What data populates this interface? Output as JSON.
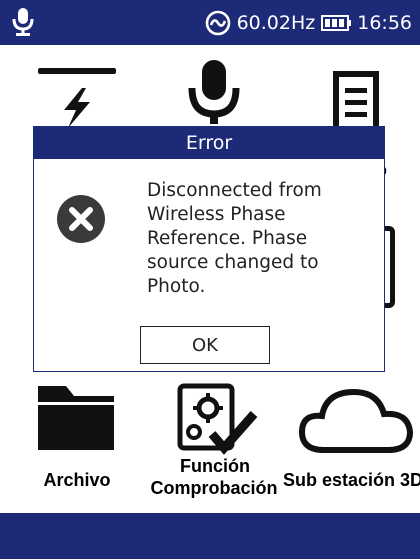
{
  "status_bar": {
    "frequency": "60.02Hz",
    "time": "16:56",
    "icons": [
      "microphone-icon",
      "phase-reference-icon",
      "battery-icon"
    ]
  },
  "tiles": [
    {
      "name": "tile-lightning",
      "label": "",
      "icon": "lightning-bar-icon"
    },
    {
      "name": "tile-microphone",
      "label": "",
      "icon": "microphone-icon"
    },
    {
      "name": "tile-document",
      "label": "o",
      "icon": "document-icon"
    },
    {
      "name": "tile-archivo",
      "label": "Archivo",
      "icon": "folder-icon"
    },
    {
      "name": "tile-funcion",
      "label_line1": "Función",
      "label_line2": "Comprobación",
      "icon": "gear-check-icon"
    },
    {
      "name": "tile-subestacion",
      "label": "Sub estación 3D",
      "icon": "cloud-icon"
    }
  ],
  "dialog": {
    "title": "Error",
    "message_lines": [
      "Disconnected from",
      "Wireless Phase",
      "Reference. Phase",
      "source changed to",
      "Photo."
    ],
    "ok_label": "OK",
    "icon": "error-x-icon"
  },
  "colors": {
    "bar": "#1d2a78",
    "icon": "#111111"
  }
}
